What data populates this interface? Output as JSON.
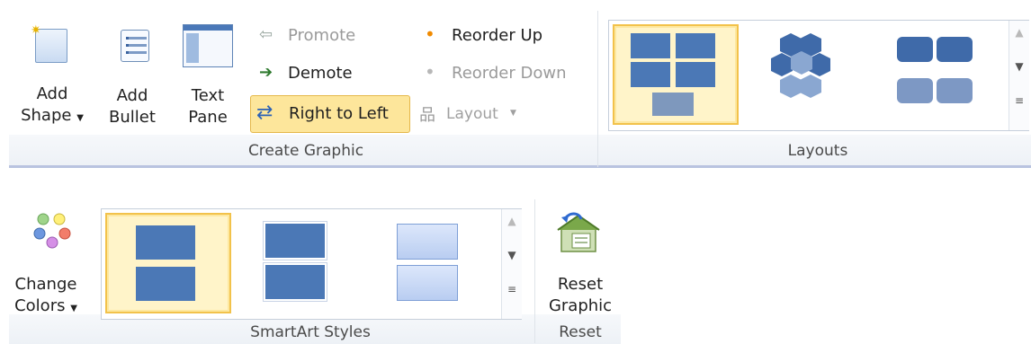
{
  "create_graphic": {
    "add_shape": "Add",
    "add_shape2": "Shape",
    "add_bullet": "Add",
    "add_bullet2": "Bullet",
    "text_pane": "Text",
    "text_pane2": "Pane",
    "promote": "Promote",
    "demote": "Demote",
    "right_to_left": "Right to Left",
    "reorder_up": "Reorder Up",
    "reorder_down": "Reorder Down",
    "layout": "Layout",
    "group_label": "Create Graphic"
  },
  "layouts": {
    "group_label": "Layouts"
  },
  "styles": {
    "change_colors": "Change",
    "change_colors2": "Colors",
    "group_label": "SmartArt Styles"
  },
  "reset": {
    "reset_graphic": "Reset",
    "reset_graphic2": "Graphic",
    "group_label": "Reset"
  },
  "colors": {
    "accent": "#4b78b6",
    "selection": "#f2c24b",
    "group_bar": "#b9c3e0"
  }
}
